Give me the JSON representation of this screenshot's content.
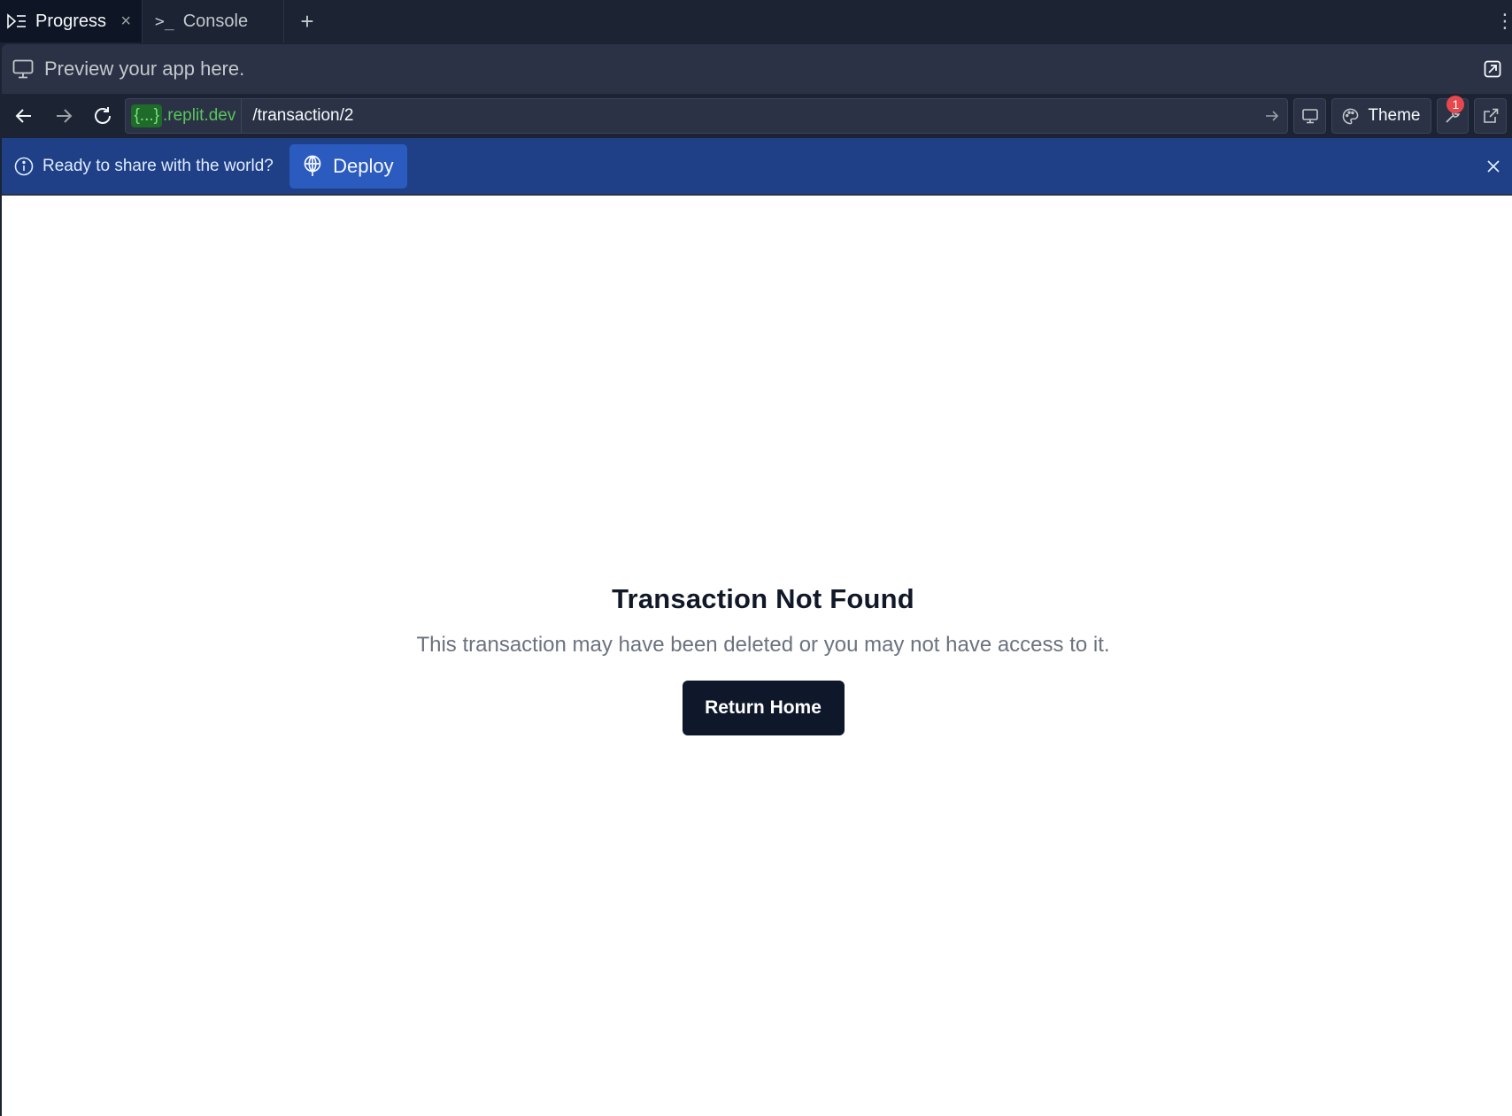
{
  "tabs": {
    "progress": {
      "label": "Progress",
      "close": "×"
    },
    "console": {
      "label": "Console",
      "prompt": ">_"
    },
    "add": "+",
    "menu": "⋮"
  },
  "preview": {
    "header_text": "Preview your app here."
  },
  "urlbar": {
    "domain_chip": "{...}",
    "domain_suffix": ".replit.dev",
    "path": "/transaction/2",
    "theme_label": "Theme",
    "notification_count": "1"
  },
  "banner": {
    "text": "Ready to share with the world?",
    "deploy_label": "Deploy"
  },
  "page": {
    "title": "Transaction Not Found",
    "message": "This transaction may have been deleted or you may not have access to it.",
    "button_label": "Return Home"
  },
  "colors": {
    "ide_background": "#1c2333",
    "banner": "#1f4086",
    "deploy_button": "#2c5bbf",
    "domain_green": "#58c65c",
    "badge_red": "#e5484d",
    "primary_button": "#0f172a"
  }
}
